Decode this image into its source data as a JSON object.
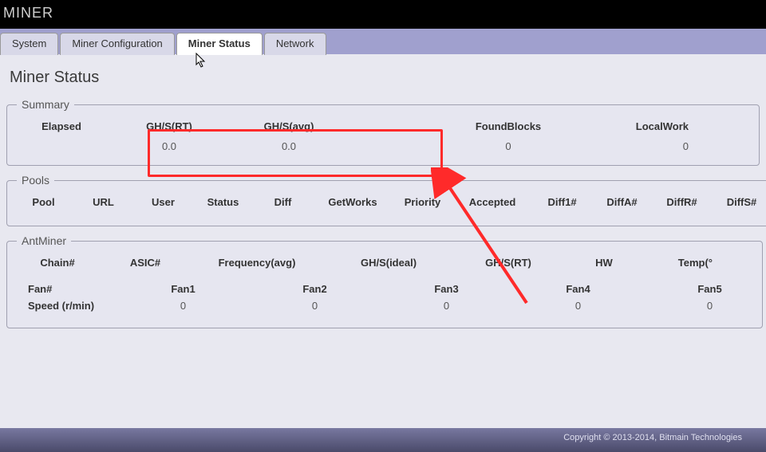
{
  "topbar": {
    "title": "MINER"
  },
  "tabs": {
    "system": "System",
    "miner_config": "Miner Configuration",
    "miner_status": "Miner Status",
    "network": "Network"
  },
  "page": {
    "title": "Miner Status"
  },
  "summary": {
    "legend": "Summary",
    "cols": {
      "elapsed": "Elapsed",
      "ghsrt": "GH/S(RT)",
      "ghsavg": "GH/S(avg)",
      "foundblocks": "FoundBlocks",
      "localwork": "LocalWork"
    },
    "vals": {
      "elapsed": "",
      "ghsrt": "0.0",
      "ghsavg": "0.0",
      "foundblocks": "0",
      "localwork": "0"
    }
  },
  "pools": {
    "legend": "Pools",
    "cols": [
      "Pool",
      "URL",
      "User",
      "Status",
      "Diff",
      "GetWorks",
      "Priority",
      "Accepted",
      "Diff1#",
      "DiffA#",
      "DiffR#",
      "DiffS#"
    ]
  },
  "antminer": {
    "legend": "AntMiner",
    "cols": [
      "Chain#",
      "ASIC#",
      "Frequency(avg)",
      "GH/S(ideal)",
      "GH/S(RT)",
      "HW",
      "Temp(°"
    ],
    "fan": {
      "row1": [
        "Fan#",
        "Fan1",
        "Fan2",
        "Fan3",
        "Fan4",
        "Fan5"
      ],
      "row2label": "Speed (r/min)",
      "row2": [
        "0",
        "0",
        "0",
        "0",
        "0"
      ]
    }
  },
  "footer": {
    "text": "Copyright © 2013-2014, Bitmain Technologies"
  }
}
